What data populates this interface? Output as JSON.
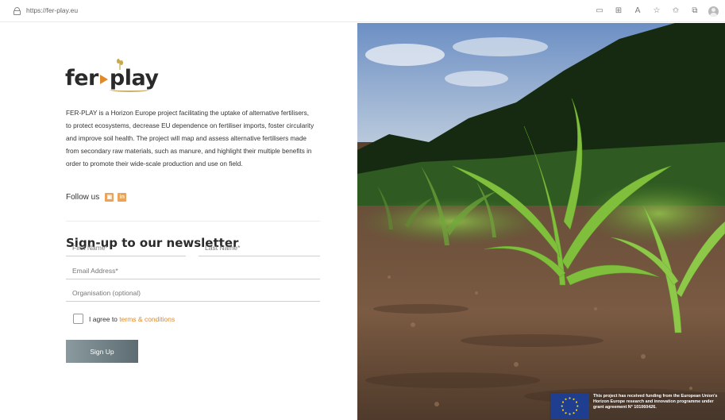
{
  "browser": {
    "url": "https://fer-play.eu",
    "toolbar_icons": [
      "reader-view-icon",
      "grid-icon",
      "read-aloud-icon",
      "favorite-add-icon",
      "favorites-icon",
      "collections-icon",
      "profile-icon"
    ]
  },
  "logo": {
    "text_left": "fer",
    "text_right": "play"
  },
  "description": "FER-PLAY is a Horizon Europe project facilitating the uptake of alternative fertilisers, to protect ecosystems, decrease EU dependence on fertiliser imports, foster circularity and improve soil health. The project will map and assess alternative fertilisers made from secondary raw materials, such as manure, and highlight their multiple benefits in order to promote their wide-scale production and use on field.",
  "follow": {
    "label": "Follow us",
    "icons": [
      "twitter-icon",
      "linkedin-icon"
    ],
    "accent": "#e9a35a"
  },
  "newsletter": {
    "title": "Sign-up to our newsletter",
    "first_name_placeholder": "First Name*",
    "last_name_placeholder": "Last Name*",
    "email_placeholder": "Email Address*",
    "org_placeholder": "Organisation (optional)",
    "agree_prefix": "I agree to",
    "terms_link": "terms & conditions",
    "submit_label": "Sign Up",
    "link_color": "#e08a2c"
  },
  "funding": {
    "text": "This project has received funding from the European Union's Horizon Europe research and innovation programme under grant agreement N° 101060426."
  }
}
